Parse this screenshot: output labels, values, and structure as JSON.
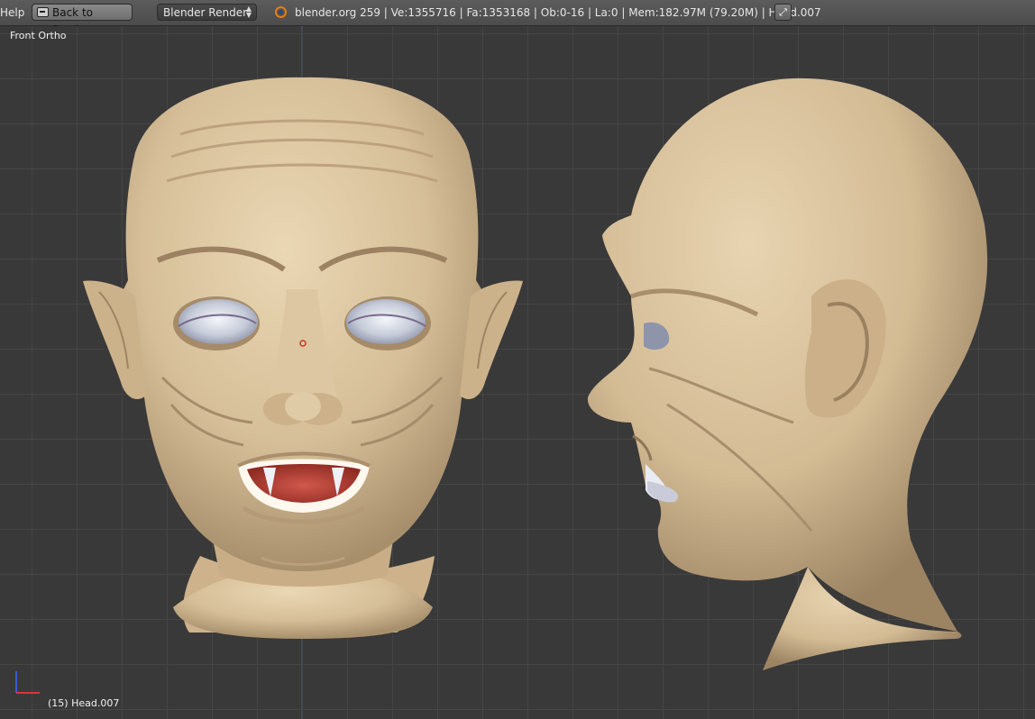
{
  "menu": {
    "help_label": "Help"
  },
  "toolbar": {
    "back_label": "Back to Previous",
    "render_engine": "Blender Render",
    "stats": "blender.org 259 | Ve:1355716 | Fa:1353168 | Ob:0-16 | La:0 | Mem:182.97M (79.20M) | Head.007",
    "icons": {
      "logo": "blender-logo-icon",
      "back": "back-screen-icon",
      "fullscreen": "fullscreen-toggle-icon"
    }
  },
  "viewport": {
    "view_name": "Front Ortho",
    "active_object": "(15) Head.007",
    "colors": {
      "background": "#393939",
      "grid": "#454545",
      "skin": "#d8c19b",
      "mouth": "#b13a30",
      "eye": "#c9cfdc"
    }
  }
}
